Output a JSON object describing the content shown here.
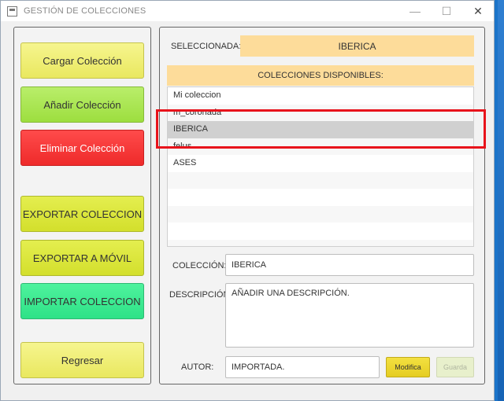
{
  "window": {
    "title": "GESTIÓN DE COLECCIONES",
    "controls": {
      "minimize": "—",
      "maximize": "☐",
      "close": "✕"
    }
  },
  "left_panel": {
    "buttons": [
      {
        "label": "Cargar Colección",
        "color": "#f0ef78"
      },
      {
        "label": "Añadir Colección",
        "color": "#aee654"
      },
      {
        "label": "Eliminar Colección",
        "color": "#f23535"
      },
      {
        "label": "EXPORTAR COLECCION",
        "color": "#dde83d"
      },
      {
        "label": "EXPORTAR A MÓVIL",
        "color": "#dde83d"
      },
      {
        "label": "IMPORTAR COLECCION",
        "color": "#3eea92"
      },
      {
        "label": "Regresar",
        "color": "#f0ef78"
      }
    ]
  },
  "right_panel": {
    "selected_label": "SELECCIONADA:",
    "selected_value": "IBERICA",
    "list_header": "COLECCIONES DISPONIBLES:",
    "collections": [
      "Mi coleccion",
      "m_coronada",
      "IBERICA",
      "felus",
      "ASES"
    ],
    "selected_index": 2,
    "coleccion_label": "COLECCIÓN:",
    "coleccion_value": "IBERICA",
    "descripcion_label": "DESCRIPCIÓN:",
    "descripcion_value": "AÑADIR UNA DESCRIPCIÓN.",
    "autor_label": "AUTOR:",
    "autor_value": "IMPORTADA.",
    "modifica_label": "Modifica",
    "guarda_label": "Guarda"
  },
  "colors": {
    "accent_orange": "#fddc9a",
    "highlight_red": "#e8131b",
    "selected_row": "#d0d0d0"
  }
}
